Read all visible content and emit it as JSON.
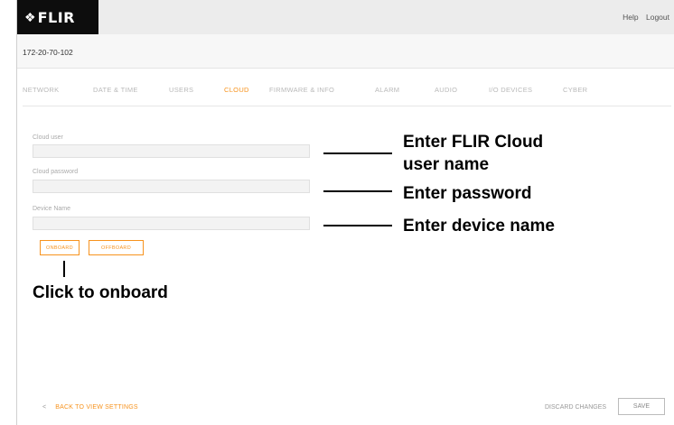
{
  "header": {
    "logo_text": "FLIR",
    "logo_icon": "flir-logo-icon",
    "help_label": "Help",
    "logout_label": "Logout"
  },
  "device": {
    "id": "172-20-70-102"
  },
  "tabs": [
    {
      "label": "NETWORK",
      "active": false
    },
    {
      "label": "DATE & TIME",
      "active": false
    },
    {
      "label": "USERS",
      "active": false
    },
    {
      "label": "CLOUD",
      "active": true
    },
    {
      "label": "FIRMWARE & INFO",
      "active": false
    },
    {
      "label": "ALARM",
      "active": false
    },
    {
      "label": "AUDIO",
      "active": false
    },
    {
      "label": "I/O DEVICES",
      "active": false
    },
    {
      "label": "CYBER",
      "active": false
    }
  ],
  "form": {
    "cloud_user_label": "Cloud user",
    "cloud_user_value": "",
    "cloud_password_label": "Cloud password",
    "cloud_password_value": "",
    "device_name_label": "Device Name",
    "device_name_value": ""
  },
  "buttons": {
    "onboard": "ONBOARD",
    "offboard": "OFFBOARD"
  },
  "annotations": {
    "user_name_line1": "Enter FLIR Cloud",
    "user_name_line2": "user name",
    "password": "Enter password",
    "device_name": "Enter device name",
    "onboard": "Click to onboard"
  },
  "footer": {
    "back_icon": "chevron-left-icon",
    "back_label": "BACK TO VIEW SETTINGS",
    "discard_label": "DISCARD CHANGES",
    "save_label": "SAVE"
  },
  "colors": {
    "accent": "#f7931e",
    "logo_bg": "#0d0d0d",
    "topbar_bg": "#ececec"
  }
}
